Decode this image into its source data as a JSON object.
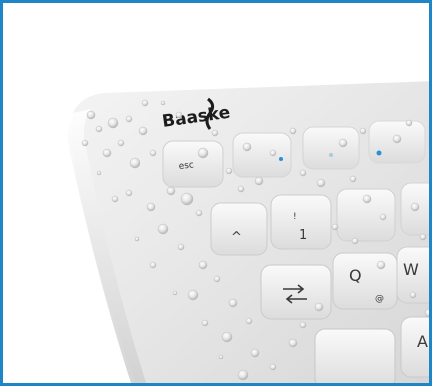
{
  "image": {
    "frame_color": "#1e86c6",
    "brand": "Baaske",
    "keys": {
      "esc": "esc",
      "caret": "^",
      "one": "1",
      "exclaim": "!",
      "q": "Q",
      "at": "@",
      "w": "W",
      "a": "A",
      "tab_icon": "tab-arrows-icon",
      "led_color": "#2a8fd6"
    }
  }
}
